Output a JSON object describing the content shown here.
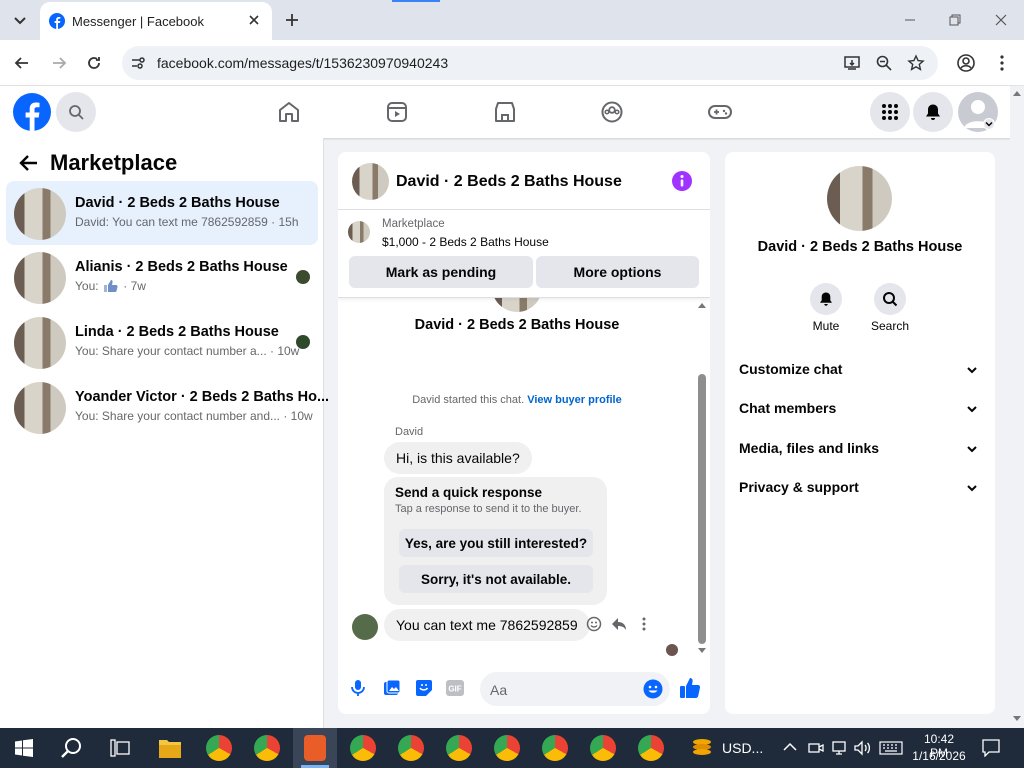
{
  "browser": {
    "tab_title": "Messenger | Facebook",
    "url": "facebook.com/messages/t/1536230970940243"
  },
  "left": {
    "title": "Marketplace",
    "conversations": [
      {
        "name": "David · 2 Beds 2 Baths House",
        "preview": "David: You can text me 7862592859 · 15h"
      },
      {
        "name": "Alianis · 2 Beds 2 Baths House",
        "preview": "You:",
        "time": "· 7w"
      },
      {
        "name": "Linda · 2 Beds 2 Baths House",
        "preview": "You: Share your contact number a... · 10w"
      },
      {
        "name": "Yoander Victor · 2 Beds 2 Baths Ho...",
        "preview": "You: Share your contact number and... · 10w"
      }
    ]
  },
  "chat": {
    "header_name": "David · 2 Beds 2 Baths House",
    "listing_source": "Marketplace",
    "listing_price": "$1,000 - 2 Beds 2 Baths House",
    "btn_pending": "Mark as pending",
    "btn_more": "More options",
    "profile_name": "David · 2 Beds 2 Baths House",
    "started_text": "David started this chat.",
    "buyer_link": "View buyer profile",
    "sender": "David",
    "msg1": "Hi, is this available?",
    "quick_title": "Send a quick response",
    "quick_sub": "Tap a response to send it to the buyer.",
    "quick_1": "Yes, are you still interested?",
    "quick_2": "Sorry, it's not available.",
    "msg2": "You can text me 7862592859",
    "input_placeholder": "Aa"
  },
  "info": {
    "name": "David · 2 Beds 2 Baths House",
    "mute": "Mute",
    "search": "Search",
    "sections": [
      "Customize chat",
      "Chat members",
      "Media, files and links",
      "Privacy & support"
    ]
  },
  "taskbar": {
    "currency": "USD...",
    "time": "10:42 PM",
    "date": "1/16/2026"
  },
  "colors": {
    "fb_blue": "#0866ff",
    "accent_purple": "#a033ff"
  }
}
